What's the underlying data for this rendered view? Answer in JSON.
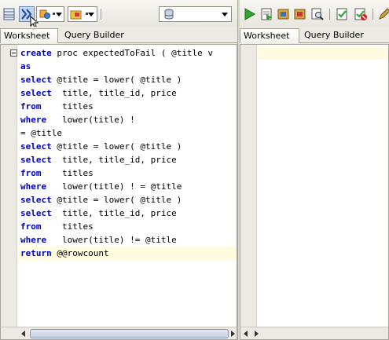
{
  "left": {
    "tabs": [
      "Worksheet",
      "Query Builder"
    ],
    "lines": [
      {
        "kw": "create",
        "rest": " proc expectedToFail ( @title v"
      },
      {
        "kw": "as",
        "rest": ""
      },
      {
        "kw": "select",
        "rest": " @title = lower( @title )"
      },
      {
        "kw": "select",
        "rest": "  title, title_id, price"
      },
      {
        "kw": "from",
        "rest": "    titles"
      },
      {
        "kw": "where",
        "rest": "   lower(title) !"
      },
      {
        "kw": "",
        "rest": "= @title"
      },
      {
        "kw": "select",
        "rest": " @title = lower( @title )"
      },
      {
        "kw": "select",
        "rest": "  title, title_id, price"
      },
      {
        "kw": "from",
        "rest": "    titles"
      },
      {
        "kw": "where",
        "rest": "   lower(title) ! = @title"
      },
      {
        "kw": "select",
        "rest": " @title = lower( @title )"
      },
      {
        "kw": "select",
        "rest": "  title, title_id, price"
      },
      {
        "kw": "from",
        "rest": "    titles"
      },
      {
        "kw": "where",
        "rest": "   lower(title) != @title"
      },
      {
        "kw": "return",
        "rest": " @@rowcount"
      }
    ]
  },
  "right": {
    "tabs": [
      "Worksheet",
      "Query Builder"
    ]
  },
  "icons": {
    "fold": "collapse-minus-icon",
    "connection": "database-icon",
    "run": "run-play-icon"
  },
  "colors": {
    "keyword": "#0000c0",
    "current_line": "#fffbe1",
    "squiggle": "#d02020"
  }
}
